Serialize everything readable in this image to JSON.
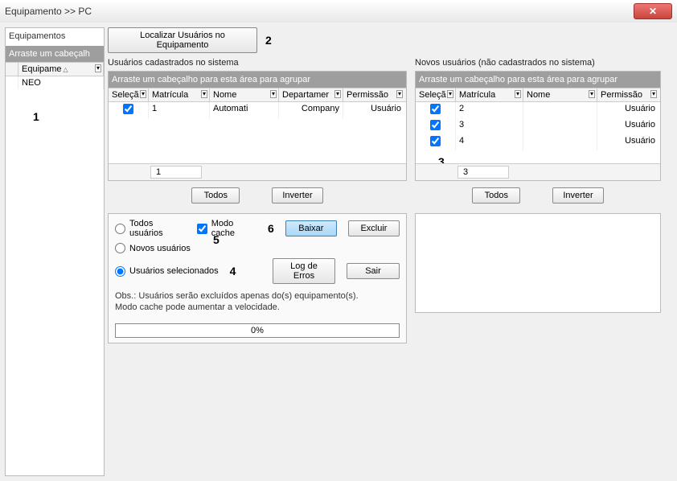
{
  "window": {
    "title": "Equipamento >> PC"
  },
  "sidebar": {
    "title": "Equipamentos",
    "group_hint": "Arraste um cabeçalh",
    "columns": [
      {
        "label": "Equipame"
      }
    ],
    "rows": [
      {
        "name": "NEO"
      }
    ]
  },
  "annotations": {
    "a1": "1",
    "a2": "2",
    "a3": "3",
    "a4": "4",
    "a5": "5",
    "a6": "6"
  },
  "buttons": {
    "localizar": "Localizar Usuários no Equipamento"
  },
  "left_table": {
    "title": "Usuários cadastrados no sistema",
    "group_hint": "Arraste um cabeçalho para esta área para agrupar",
    "columns": [
      "Seleçã",
      "Matrícula",
      "Nome",
      "Departamer",
      "Permissão"
    ],
    "rows": [
      {
        "sel": true,
        "matricula": "1",
        "nome": "Automati",
        "dept": "Company",
        "perm": "Usuário"
      }
    ],
    "count": "1",
    "btn_all": "Todos",
    "btn_invert": "Inverter"
  },
  "right_table": {
    "title": "Novos usuários (não cadastrados no sistema)",
    "group_hint": "Arraste um cabeçalho para esta área para agrupar",
    "columns": [
      "Seleçã",
      "Matrícula",
      "Nome",
      "Permissão"
    ],
    "rows": [
      {
        "sel": true,
        "matricula": "2",
        "nome": "",
        "perm": "Usuário"
      },
      {
        "sel": true,
        "matricula": "3",
        "nome": "",
        "perm": "Usuário"
      },
      {
        "sel": true,
        "matricula": "4",
        "nome": "",
        "perm": "Usuário"
      }
    ],
    "count": "3",
    "btn_all": "Todos",
    "btn_invert": "Inverter"
  },
  "options": {
    "radio_all": "Todos usuários",
    "radio_new": "Novos usuários",
    "radio_selected": "Usuários selecionados",
    "cache_mode": "Modo cache",
    "cache_checked": true,
    "selected_radio": "selected",
    "btn_baixar": "Baixar",
    "btn_excluir": "Excluir",
    "btn_log": "Log de Erros",
    "btn_sair": "Sair",
    "note_line1": "Obs.: Usuários serão excluídos apenas do(s) equipamento(s).",
    "note_line2": "Modo cache pode aumentar a velocidade."
  },
  "progress": {
    "text": "0%"
  }
}
